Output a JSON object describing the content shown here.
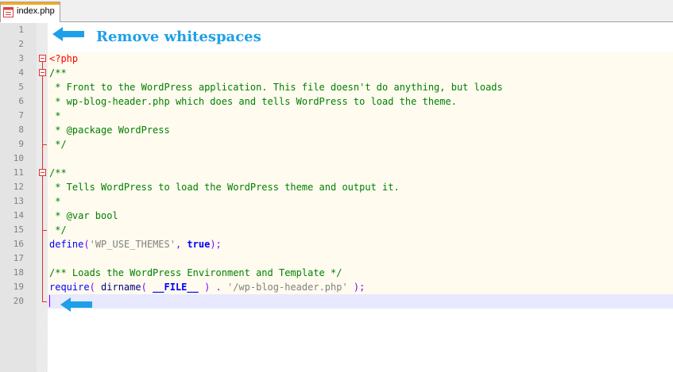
{
  "tab": {
    "label": "index.php",
    "icon": "php-file-icon",
    "accent_color": "#f9a91d"
  },
  "annotation": {
    "text": "Remove whitespaces",
    "color": "#1ea0e8"
  },
  "lines": [
    {
      "number": "1"
    },
    {
      "number": "2"
    },
    {
      "number": "3",
      "tokens": [
        {
          "c": "tok-tag",
          "t": "<?php"
        }
      ]
    },
    {
      "number": "4",
      "tokens": [
        {
          "c": "tok-comment",
          "t": "/**"
        }
      ]
    },
    {
      "number": "5",
      "tokens": [
        {
          "c": "tok-comment",
          "t": " * Front to the WordPress application. This file doesn't do anything, but loads"
        }
      ]
    },
    {
      "number": "6",
      "tokens": [
        {
          "c": "tok-comment",
          "t": " * wp-blog-header.php which does and tells WordPress to load the theme."
        }
      ]
    },
    {
      "number": "7",
      "tokens": [
        {
          "c": "tok-comment",
          "t": " *"
        }
      ]
    },
    {
      "number": "8",
      "tokens": [
        {
          "c": "tok-comment",
          "t": " * @package WordPress"
        }
      ]
    },
    {
      "number": "9",
      "tokens": [
        {
          "c": "tok-comment",
          "t": " */"
        }
      ]
    },
    {
      "number": "10"
    },
    {
      "number": "11",
      "tokens": [
        {
          "c": "tok-comment",
          "t": "/**"
        }
      ]
    },
    {
      "number": "12",
      "tokens": [
        {
          "c": "tok-comment",
          "t": " * Tells WordPress to load the WordPress theme and output it."
        }
      ]
    },
    {
      "number": "13",
      "tokens": [
        {
          "c": "tok-comment",
          "t": " *"
        }
      ]
    },
    {
      "number": "14",
      "tokens": [
        {
          "c": "tok-comment",
          "t": " * @var bool"
        }
      ]
    },
    {
      "number": "15",
      "tokens": [
        {
          "c": "tok-comment",
          "t": " */"
        }
      ]
    },
    {
      "number": "16",
      "tokens": [
        {
          "c": "tok-kw",
          "t": "define"
        },
        {
          "c": "tok-op",
          "t": "("
        },
        {
          "c": "tok-str",
          "t": "'WP_USE_THEMES'"
        },
        {
          "c": "tok-op",
          "t": ", "
        },
        {
          "c": "tok-kwb",
          "t": "true"
        },
        {
          "c": "tok-op",
          "t": ");"
        }
      ]
    },
    {
      "number": "17"
    },
    {
      "number": "18",
      "tokens": [
        {
          "c": "tok-comment",
          "t": "/** Loads the WordPress Environment and Template */"
        }
      ]
    },
    {
      "number": "19",
      "tokens": [
        {
          "c": "tok-kw",
          "t": "require"
        },
        {
          "c": "tok-op",
          "t": "( "
        },
        {
          "c": "tok-plain",
          "t": "dirname"
        },
        {
          "c": "tok-op",
          "t": "( "
        },
        {
          "c": "tok-kwb",
          "t": "__FILE__"
        },
        {
          "c": "tok-op",
          "t": " ) . "
        },
        {
          "c": "tok-str",
          "t": "'/wp-blog-header.php'"
        },
        {
          "c": "tok-op",
          "t": " );"
        }
      ]
    },
    {
      "number": "20"
    }
  ]
}
